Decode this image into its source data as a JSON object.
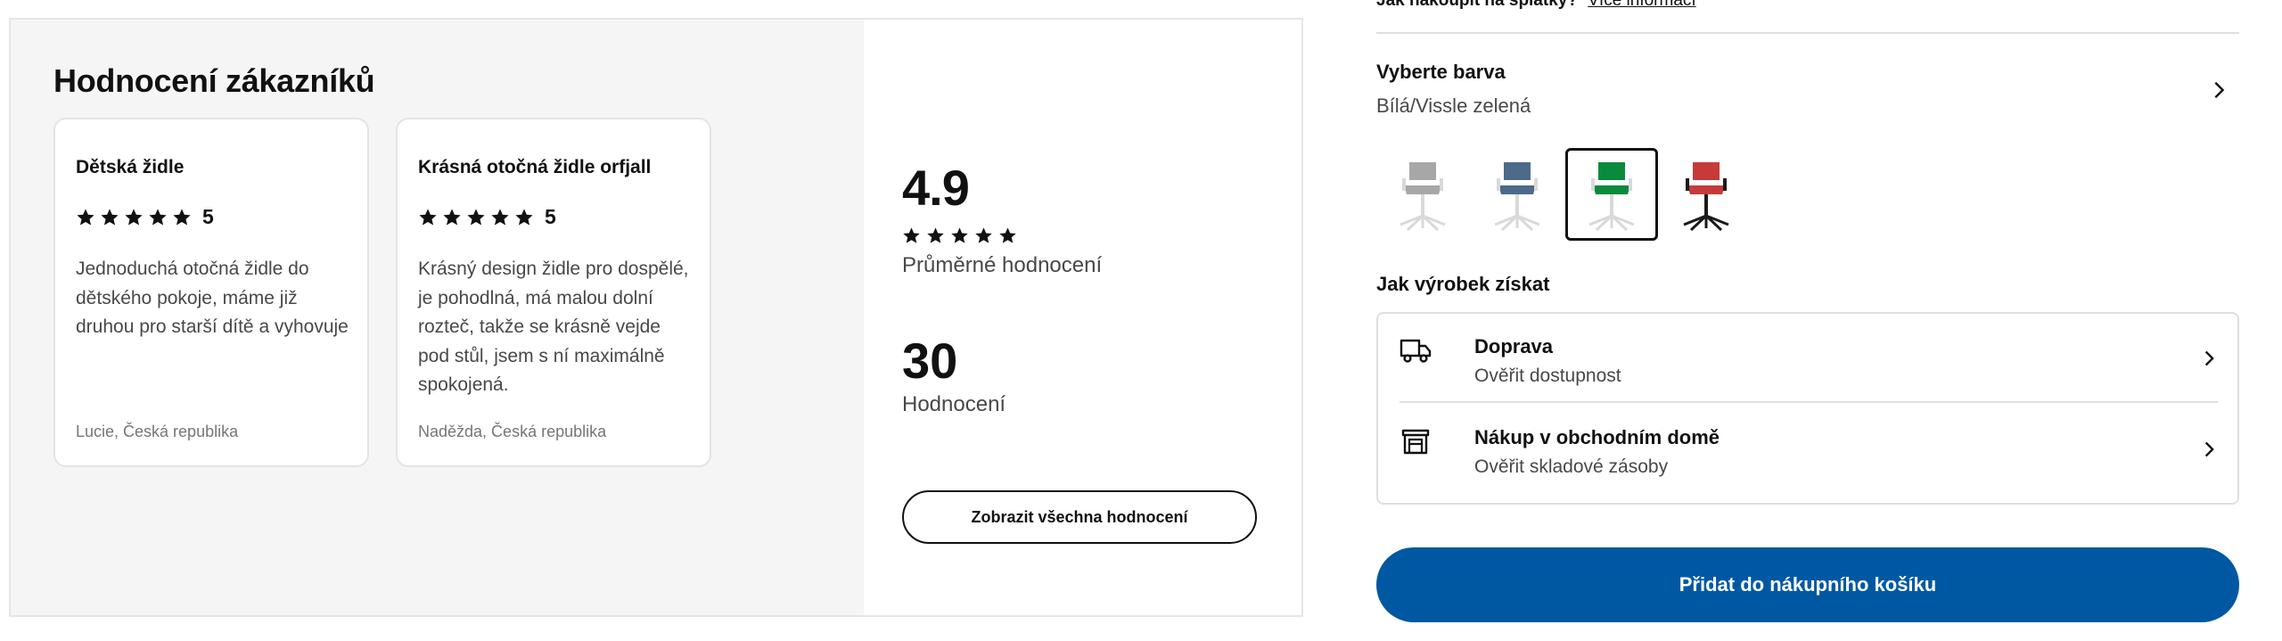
{
  "reviews": {
    "heading": "Hodnocení zákazníků",
    "cards": [
      {
        "title": "Dětská židle",
        "rating": "5",
        "text": "Jednoduchá otočná židle do dětského pokoje, máme již druhou pro starší dítě a vyhovuje",
        "author": "Lucie, Česká republika"
      },
      {
        "title": "Krásná otočná židle orfjall",
        "rating": "5",
        "text": "Krásný design židle pro dospělé, je pohodlná, má malou dolní rozteč, takže se krásně vejde pod stůl, jsem s ní maximálně spokojená.",
        "author": "Naděžda, Česká republika"
      }
    ],
    "summary": {
      "average": "4.9",
      "average_label": "Průměrné hodnocení",
      "count": "30",
      "count_label": "Hodnocení",
      "show_all_label": "Zobrazit všechna hodnocení"
    }
  },
  "installment": {
    "question": "Jak nakoupit na splátky?",
    "link": "Více informací"
  },
  "color": {
    "title": "Vyberte barva",
    "value": "Bílá/Vissle zelená",
    "swatches": [
      {
        "name": "light-grey",
        "seat": "#a7a7a7",
        "base": "#d9d9d9"
      },
      {
        "name": "blue",
        "seat": "#4d6a8b",
        "base": "#d9d9d9"
      },
      {
        "name": "green",
        "seat": "#0a8a3c",
        "base": "#d9d9d9",
        "selected": true
      },
      {
        "name": "red",
        "seat": "#c63a3a",
        "base": "#1a1a1a"
      }
    ]
  },
  "obtain": {
    "title": "Jak výrobek získat",
    "options": [
      {
        "icon": "truck-icon",
        "title": "Doprava",
        "subtitle": "Ověřit dostupnost"
      },
      {
        "icon": "store-icon",
        "title": "Nákup v obchodním domě",
        "subtitle": "Ověřit skladové zásoby"
      }
    ]
  },
  "cart": {
    "add_label": "Přidat do nákupního košíku",
    "button_color": "#0058a3"
  }
}
